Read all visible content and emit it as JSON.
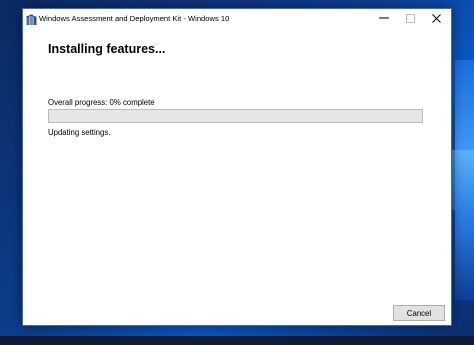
{
  "window": {
    "title": "Windows Assessment and Deployment Kit - Windows 10"
  },
  "titlebar_buttons": {
    "minimize_icon": "minimize-icon",
    "maximize_icon": "maximize-icon",
    "close_icon": "close-icon"
  },
  "main": {
    "heading": "Installing features...",
    "progress_label": "Overall progress: 0% complete",
    "progress_value": 0,
    "status": "Updating settings."
  },
  "footer": {
    "cancel_label": "Cancel"
  },
  "colors": {
    "progress_fill": "#06b025",
    "progress_track": "#e6e6e6",
    "desktop_accent": "#0d3f8f"
  }
}
